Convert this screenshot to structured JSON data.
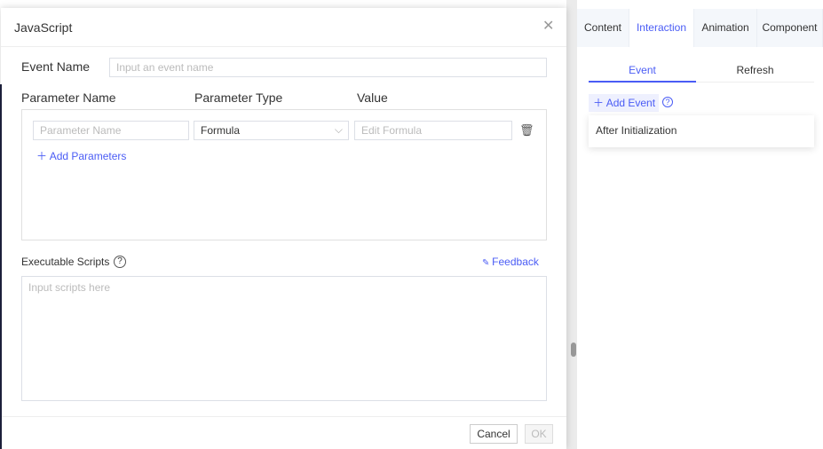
{
  "dialog": {
    "title": "JavaScript",
    "close_icon": "close-icon",
    "event_name_label": "Event Name",
    "event_name_placeholder": "Input an event name",
    "columns": [
      "Parameter Name",
      "Parameter Type",
      "Value"
    ],
    "param_row": {
      "name_placeholder": "Parameter Name",
      "type_value": "Formula",
      "value_placeholder": "Edit Formula"
    },
    "add_parameters": "Add Parameters",
    "scripts_label": "Executable Scripts",
    "feedback": "Feedback",
    "scripts_placeholder": "Input scripts here",
    "cancel": "Cancel",
    "ok": "OK"
  },
  "panel": {
    "tabs": [
      "Content",
      "Interaction",
      "Animation",
      "Component"
    ],
    "active_tab": "Interaction",
    "subtabs": [
      "Event",
      "Refresh"
    ],
    "add_event": "Add Event",
    "events": [
      "After Initialization"
    ]
  },
  "colors": {
    "accent": "#4a5cf5"
  }
}
